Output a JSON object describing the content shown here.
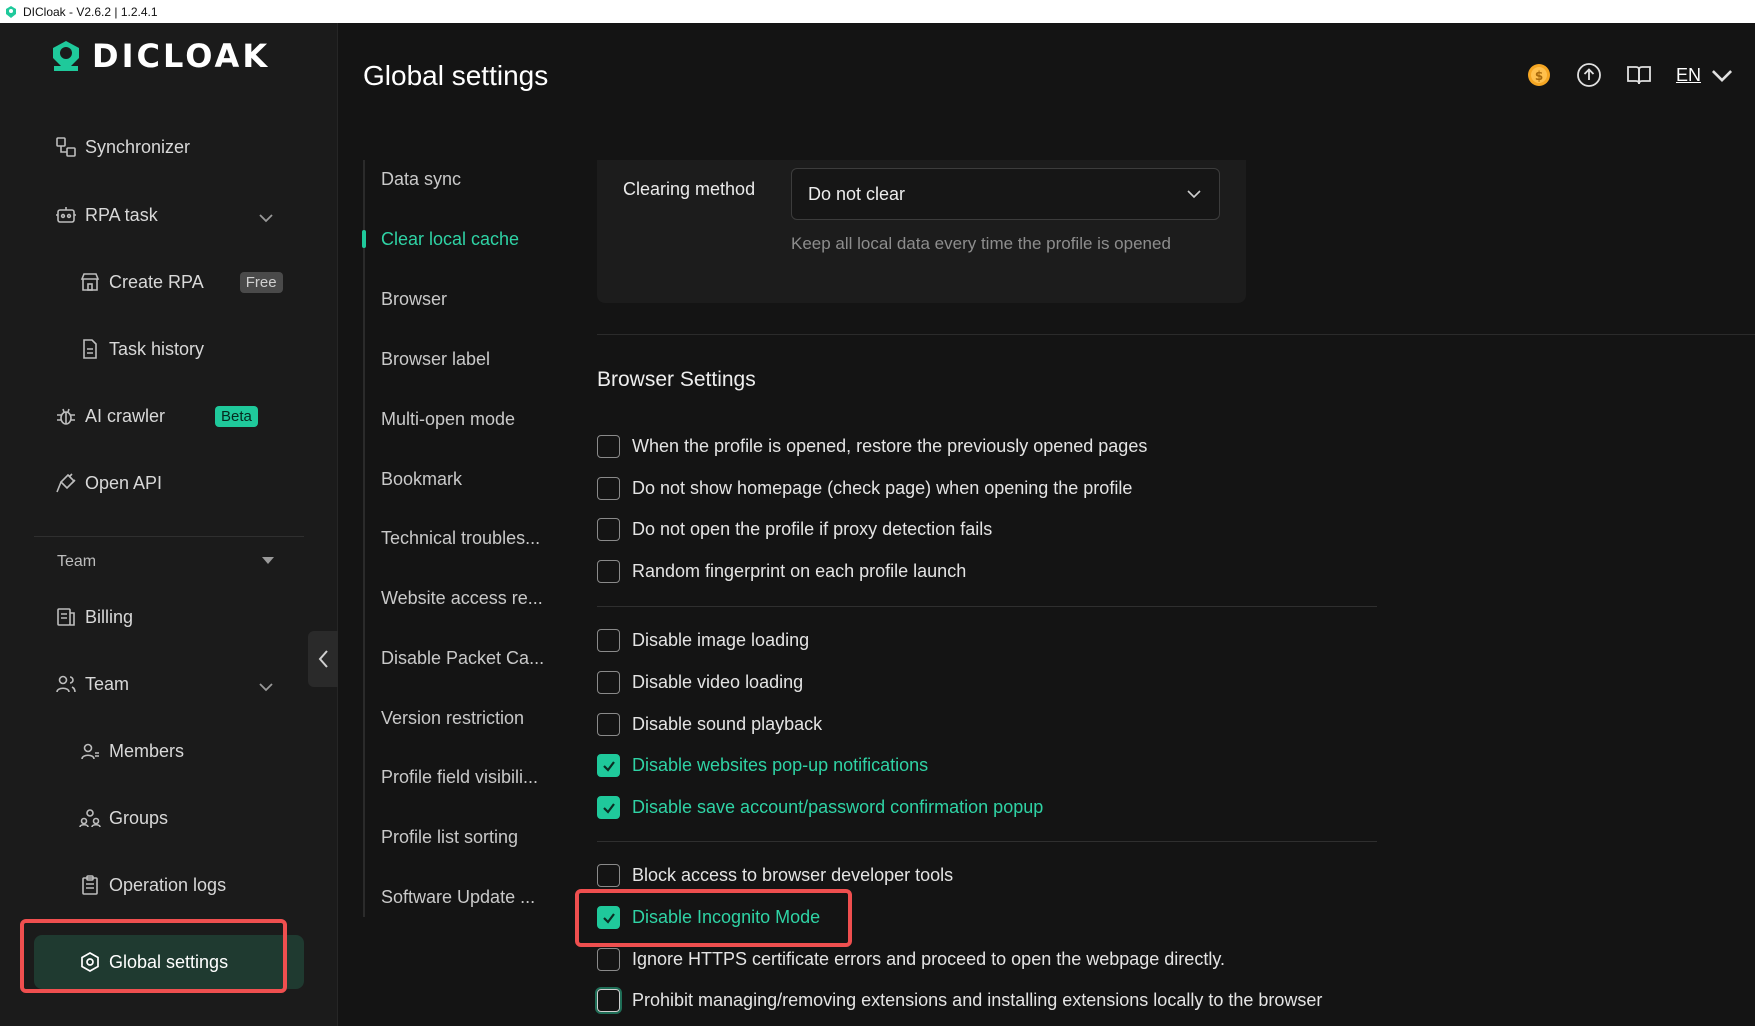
{
  "window": {
    "title": "DICloak - V2.6.2 | 1.2.4.1"
  },
  "brand": {
    "name": "DICLOAK",
    "accent": "#1fc99b",
    "highlight": "#ef4f4f"
  },
  "sidebar": {
    "synchronizer": "Synchronizer",
    "rpa_task": "RPA task",
    "create_rpa": "Create RPA",
    "free_badge": "Free",
    "task_history": "Task history",
    "ai_crawler": "AI crawler",
    "beta_badge": "Beta",
    "open_api": "Open API",
    "team_section": "Team",
    "billing": "Billing",
    "team": "Team",
    "members": "Members",
    "groups": "Groups",
    "operation_logs": "Operation logs",
    "global_settings": "Global settings"
  },
  "header": {
    "title": "Global settings",
    "language": "EN",
    "icons": [
      "coin-icon",
      "upload-icon",
      "book-icon",
      "chevron-down-icon"
    ]
  },
  "subnav": {
    "items": [
      "Data sync",
      "Clear local cache",
      "Browser",
      "Browser label",
      "Multi-open mode",
      "Bookmark",
      "Technical troubles...",
      "Website access re...",
      "Disable Packet Ca...",
      "Version restriction",
      "Profile field visibili...",
      "Profile list sorting",
      "Software Update ..."
    ],
    "active": "Clear local cache"
  },
  "cache": {
    "label": "Clearing method",
    "value": "Do not clear",
    "hint": "Keep all local data every time the profile is opened"
  },
  "browser_settings": {
    "title": "Browser Settings",
    "options": [
      {
        "label": "When the profile is opened, restore the previously opened pages",
        "checked": false
      },
      {
        "label": "Do not show homepage (check page) when opening the profile",
        "checked": false
      },
      {
        "label": "Do not open the profile if proxy detection fails",
        "checked": false
      },
      {
        "label": "Random fingerprint on each profile launch",
        "checked": false
      },
      {
        "label": "Disable image loading",
        "checked": false
      },
      {
        "label": "Disable video loading",
        "checked": false
      },
      {
        "label": "Disable sound playback",
        "checked": false
      },
      {
        "label": "Disable websites pop-up notifications",
        "checked": true
      },
      {
        "label": "Disable save account/password confirmation popup",
        "checked": true
      },
      {
        "label": "Block access to browser developer tools",
        "checked": false
      },
      {
        "label": "Disable Incognito Mode",
        "checked": true
      },
      {
        "label": "Ignore HTTPS certificate errors and proceed to open the webpage directly.",
        "checked": false
      },
      {
        "label": "Prohibit managing/removing extensions and installing extensions locally to the browser",
        "checked": false
      }
    ]
  }
}
